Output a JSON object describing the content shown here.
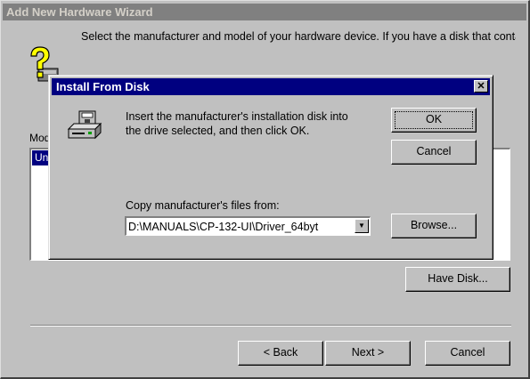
{
  "wizard": {
    "title": "Add New Hardware Wizard",
    "instruction": "Select the manufacturer and model of your hardware device. If you have a disk that contains the updated driver, click Have Disk. To install the updated",
    "models_label": "Mod",
    "models_item": "Un",
    "have_disk": "Have Disk...",
    "back": "< Back",
    "next": "Next >",
    "cancel": "Cancel"
  },
  "dialog": {
    "title": "Install From Disk",
    "close": "✕",
    "message": "Insert the manufacturer's installation disk into the drive selected, and then click OK.",
    "ok": "OK",
    "cancel": "Cancel",
    "copy_label": "Copy manufacturer's files from:",
    "path": "D:\\MANUALS\\CP-132-UI\\Driver_64byt",
    "browse": "Browse..."
  },
  "icons": {
    "wizard": "question-hardware-icon",
    "disk": "disk-drive-icon",
    "dropdown": "chevron-down-icon"
  }
}
